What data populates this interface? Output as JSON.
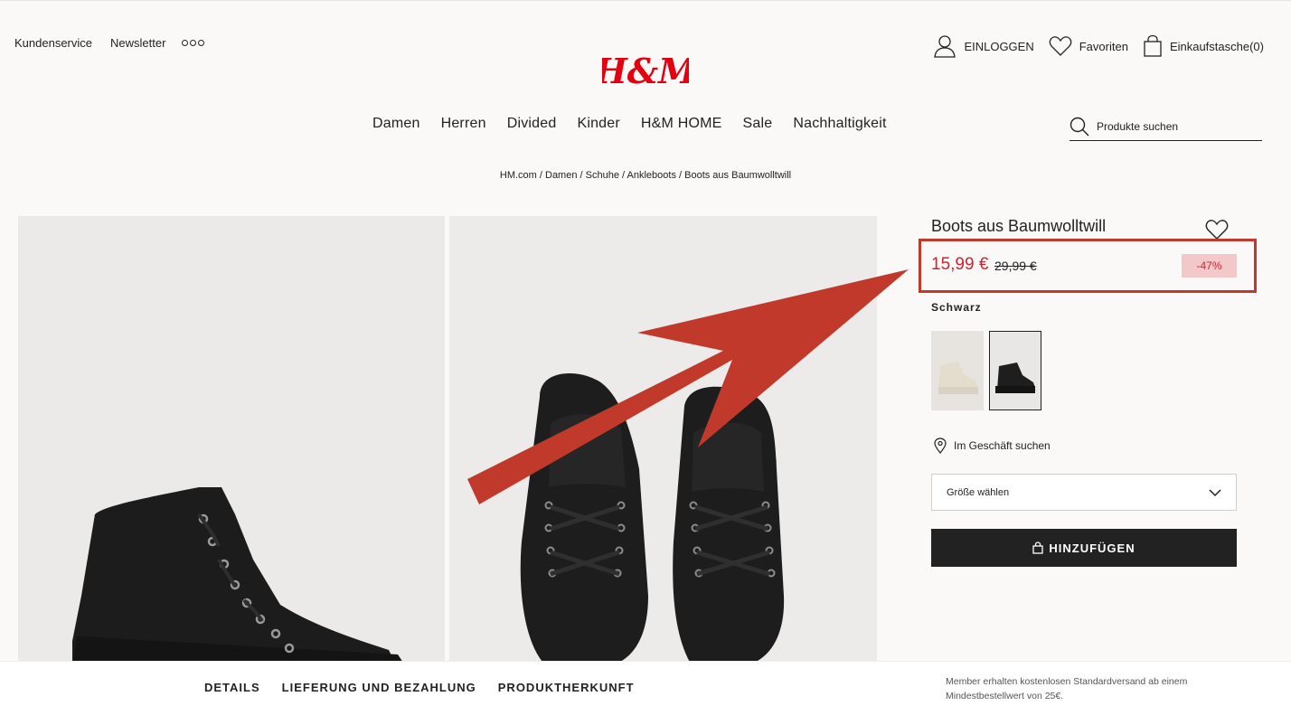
{
  "header": {
    "util_left": {
      "customer_service": "Kundenservice",
      "newsletter": "Newsletter"
    },
    "logo": "H&M",
    "util_right": {
      "login": "EINLOGGEN",
      "favorites": "Favoriten",
      "bag": "Einkaufstasche(0)"
    },
    "nav": [
      "Damen",
      "Herren",
      "Divided",
      "Kinder",
      "H&M HOME",
      "Sale",
      "Nachhaltigkeit"
    ],
    "search": {
      "placeholder": "Produkte suchen"
    }
  },
  "breadcrumb": [
    "HM.com",
    "Damen",
    "Schuhe",
    "Ankleboots",
    "Boots aus Baumwolltwill"
  ],
  "product": {
    "title": "Boots aus Baumwolltwill",
    "price_new": "15,99 €",
    "price_old": "29,99 €",
    "discount": "-47%",
    "color_label": "Schwarz",
    "find_in_store": "Im Geschäft suchen",
    "size_select": "Größe wählen",
    "add_button": "HINZUFÜGEN"
  },
  "bottom": {
    "tabs": [
      "DETAILS",
      "LIEFERUNG UND BEZAHLUNG",
      "PRODUKTHERKUNFT"
    ],
    "member_note": "Member erhalten kostenlosen Standardversand ab einem Mindestbestellwert von 25€."
  },
  "colors": {
    "brand_red": "#e50010",
    "sale_red": "#d6202e",
    "annotation_red": "#c1392b",
    "badge_bg": "#f3c8c8",
    "dark": "#222222"
  },
  "icons": [
    "user-icon",
    "heart-icon",
    "bag-icon",
    "search-icon",
    "location-pin-icon",
    "chevron-down-icon",
    "lock-bag-icon",
    "more-dots-icon"
  ]
}
